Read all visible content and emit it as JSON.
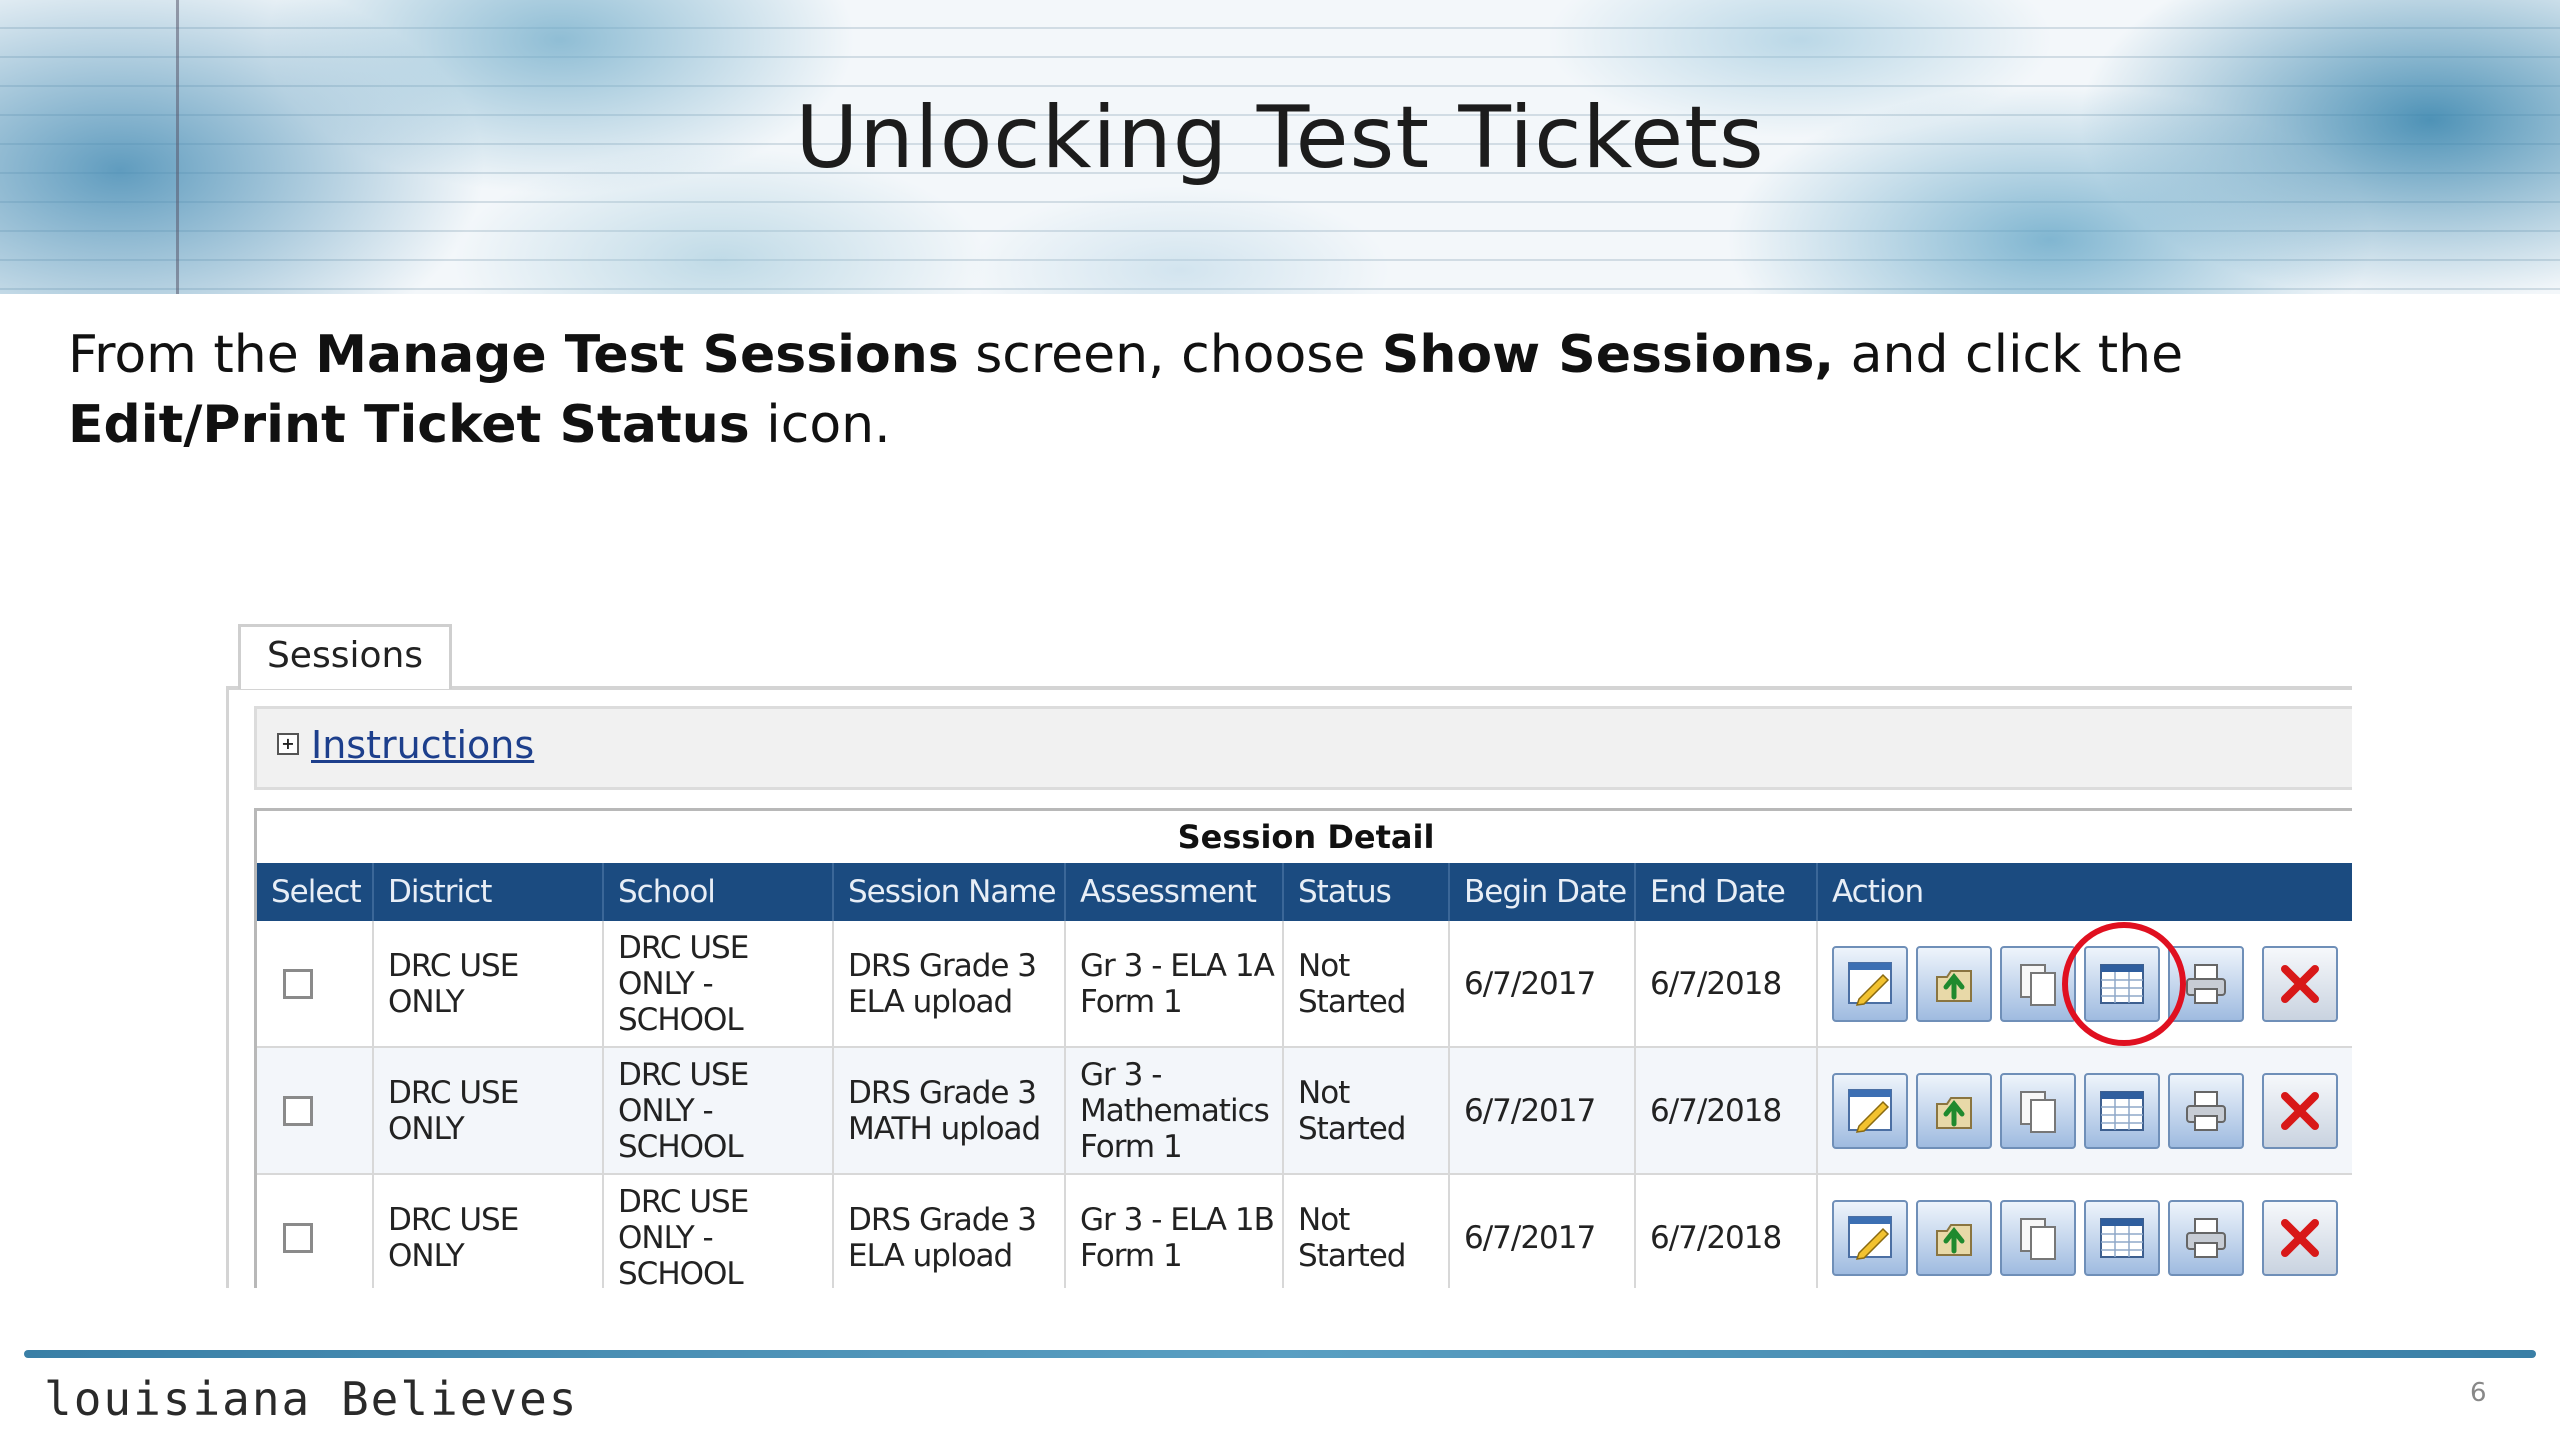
{
  "slide": {
    "title": "Unlocking Test Tickets",
    "instruction": {
      "t1": "From the ",
      "b1": "Manage Test Sessions",
      "t2": " screen, choose ",
      "b2": "Show Sessions,",
      "t3": " and click the ",
      "b3": "Edit/Print Ticket Status",
      "t4": " icon."
    },
    "footer_brand": "louisiana Believes",
    "page_number": "6"
  },
  "screenshot": {
    "tab_label": "Sessions",
    "instructions_link": "Instructions",
    "expand_glyph": "+",
    "caption": "Session Detail",
    "columns": [
      "Select",
      "District",
      "School",
      "Session Name",
      "Assessment",
      "Status",
      "Begin Date",
      "End Date",
      "Action"
    ],
    "rows": [
      {
        "district": [
          "DRC USE",
          "ONLY"
        ],
        "school": [
          "DRC USE",
          "ONLY -",
          "SCHOOL"
        ],
        "session_name": [
          "DRS Grade 3",
          "ELA upload"
        ],
        "assessment": [
          "Gr 3 - ELA 1A",
          "Form 1"
        ],
        "status": [
          "Not",
          "Started"
        ],
        "begin": "6/7/2017",
        "end": "6/7/2018"
      },
      {
        "district": [
          "DRC USE",
          "ONLY"
        ],
        "school": [
          "DRC USE",
          "ONLY -",
          "SCHOOL"
        ],
        "session_name": [
          "DRS Grade 3",
          "MATH upload"
        ],
        "assessment": [
          "Gr 3 -",
          "Mathematics",
          "Form 1"
        ],
        "status": [
          "Not",
          "Started"
        ],
        "begin": "6/7/2017",
        "end": "6/7/2018"
      },
      {
        "district": [
          "DRC USE",
          "ONLY"
        ],
        "school": [
          "DRC USE",
          "ONLY -",
          "SCHOOL"
        ],
        "session_name": [
          "DRS Grade 3",
          "ELA upload"
        ],
        "assessment": [
          "Gr 3 - ELA 1B",
          "Form 1"
        ],
        "status": [
          "Not",
          "Started"
        ],
        "begin": "6/7/2017",
        "end": "6/7/2018"
      }
    ],
    "action_icons": [
      "edit-session-icon",
      "upload-students-icon",
      "copy-session-icon",
      "edit-print-ticket-status-icon",
      "print-icon",
      "delete-icon"
    ],
    "highlighted_icon": "edit-print-ticket-status-icon",
    "colors": {
      "header_bg": "#1b4b80",
      "link": "#1d3f8c",
      "highlight": "#e01020"
    }
  }
}
